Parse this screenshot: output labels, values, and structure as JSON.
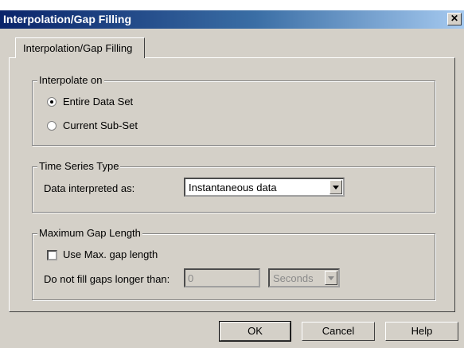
{
  "window": {
    "title": "Interpolation/Gap Filling",
    "close_symbol": "✕"
  },
  "tabs": [
    {
      "label": "Interpolation/Gap Filling"
    }
  ],
  "interpolate_on": {
    "label": "Interpolate on",
    "options": [
      {
        "label": "Entire Data Set",
        "checked": true
      },
      {
        "label": "Current Sub-Set",
        "checked": false
      }
    ]
  },
  "time_series_type": {
    "label": "Time Series Type",
    "field_label": "Data interpreted as:",
    "selected": "Instantaneous data"
  },
  "max_gap_length": {
    "label": "Maximum Gap Length",
    "checkbox_label": "Use Max. gap length",
    "checkbox_checked": false,
    "gap_label": "Do not fill gaps longer than:",
    "gap_value": "0",
    "unit_selected": "Seconds"
  },
  "buttons": {
    "ok": "OK",
    "cancel": "Cancel",
    "help": "Help"
  }
}
